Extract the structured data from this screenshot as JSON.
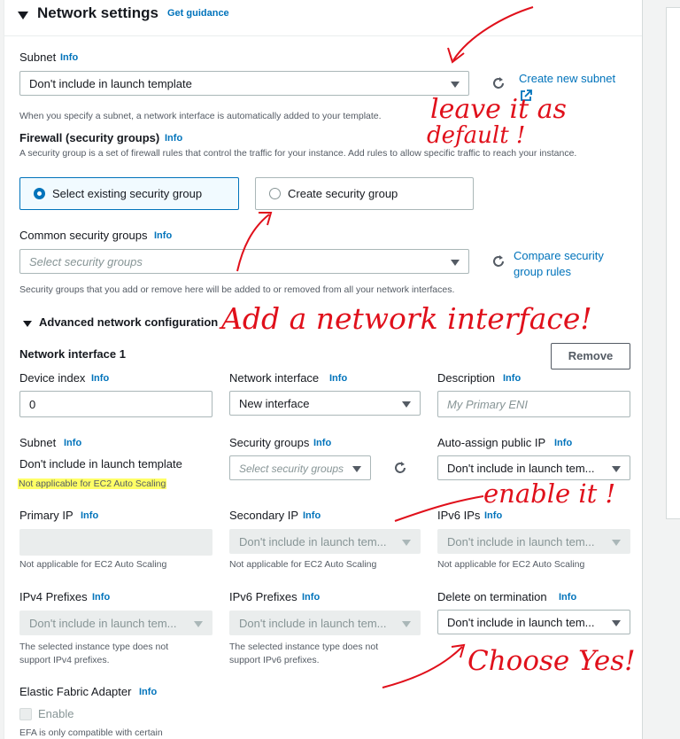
{
  "header": {
    "title": "Network settings",
    "guidance": "Get guidance"
  },
  "subnet": {
    "label": "Subnet",
    "info": "Info",
    "value": "Don't include in launch template",
    "create_link": "Create new subnet",
    "help": "When you specify a subnet, a network interface is automatically added to your template."
  },
  "firewall": {
    "label": "Firewall (security groups)",
    "info": "Info",
    "help": "A security group is a set of firewall rules that control the traffic for your instance. Add rules to allow specific traffic to reach your instance.",
    "option_existing": "Select existing security group",
    "option_create": "Create security group"
  },
  "common_sg": {
    "label": "Common security groups",
    "info": "Info",
    "placeholder": "Select security groups",
    "compare_link": "Compare security group rules",
    "help": "Security groups that you add or remove here will be added to or removed from all your network interfaces."
  },
  "advanced": {
    "label": "Advanced network configuration",
    "ni_title": "Network interface 1",
    "remove": "Remove",
    "device_index": {
      "label": "Device index",
      "info": "Info",
      "value": "0"
    },
    "network_interface": {
      "label": "Network interface",
      "info": "Info",
      "value": "New interface"
    },
    "description": {
      "label": "Description",
      "info": "Info",
      "placeholder": "My Primary ENI"
    },
    "subnet": {
      "label": "Subnet",
      "info": "Info",
      "value": "Don't include in launch template",
      "note": "Not applicable for EC2 Auto Scaling"
    },
    "security_groups": {
      "label": "Security groups",
      "info": "Info",
      "placeholder": "Select security groups"
    },
    "auto_assign": {
      "label": "Auto-assign public IP",
      "info": "Info",
      "value": "Don't include in launch tem..."
    },
    "primary_ip": {
      "label": "Primary IP",
      "info": "Info",
      "note": "Not applicable for EC2 Auto Scaling"
    },
    "secondary_ip": {
      "label": "Secondary IP",
      "info": "Info",
      "value": "Don't include in launch tem...",
      "note": "Not applicable for EC2 Auto Scaling"
    },
    "ipv6_ips": {
      "label": "IPv6 IPs",
      "info": "Info",
      "value": "Don't include in launch tem...",
      "note": "Not applicable for EC2 Auto Scaling"
    },
    "ipv4_prefixes": {
      "label": "IPv4 Prefixes",
      "info": "Info",
      "value": "Don't include in launch tem...",
      "note1": "The selected instance type does not",
      "note2": "support IPv4 prefixes."
    },
    "ipv6_prefixes": {
      "label": "IPv6 Prefixes",
      "info": "Info",
      "value": "Don't include in launch tem...",
      "note1": "The selected instance type does not",
      "note2": "support IPv6 prefixes."
    },
    "delete_on_termination": {
      "label": "Delete on termination",
      "info": "Info",
      "value": "Don't include in launch tem..."
    },
    "efa": {
      "label": "Elastic Fabric Adapter",
      "info": "Info",
      "checkbox": "Enable",
      "note": "EFA is only compatible with certain"
    }
  },
  "annotations": {
    "a1_line1": "leave it as",
    "a1_line2": "default !",
    "a2": "Add a network interface!",
    "a3": "enable it !",
    "a4": "Choose Yes!",
    "color": "#e0101b"
  }
}
